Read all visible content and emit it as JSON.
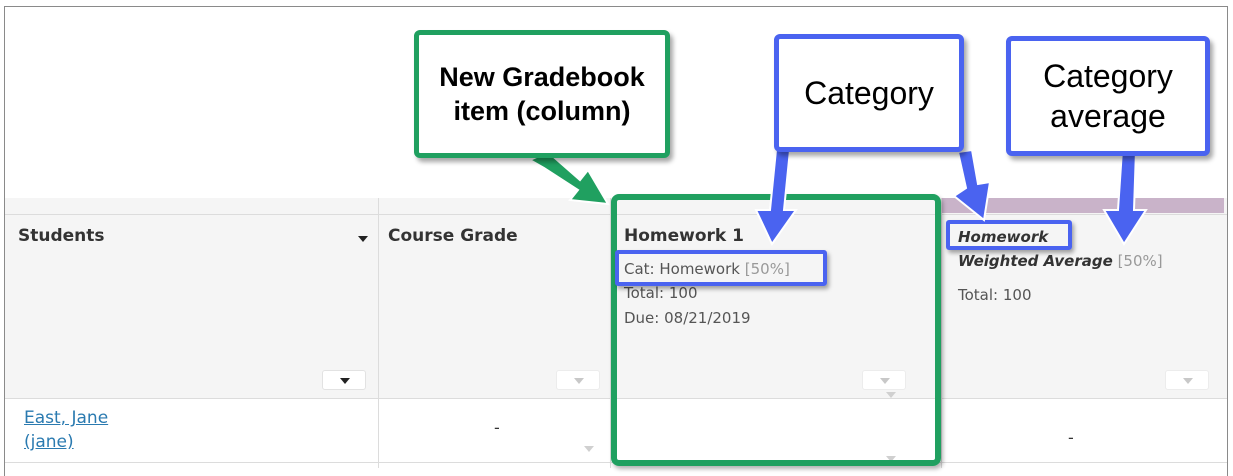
{
  "columns": {
    "students": {
      "title": "Students"
    },
    "course_grade": {
      "title": "Course Grade"
    },
    "homework1": {
      "title": "Homework 1",
      "cat_label": "Cat: Homework",
      "cat_weight": "[50%]",
      "total": "Total: 100",
      "due": "Due: 08/21/2019"
    },
    "category_avg": {
      "title_line1": "Homework",
      "title_line2": "Weighted Average",
      "weight": "[50%]",
      "total": "Total: 100"
    }
  },
  "rows": [
    {
      "student_name": "East, Jane",
      "student_username": "(jane)",
      "course_grade": "-",
      "homework1": "",
      "category_avg": "-"
    }
  ],
  "callouts": {
    "new_item": "New Gradebook item (column)",
    "category": "Category",
    "category_average": "Category average"
  },
  "colors": {
    "green": "#20a060",
    "blue": "#4a63f0",
    "link": "#2a7ab0",
    "category_strip": "#c9b3c9"
  }
}
